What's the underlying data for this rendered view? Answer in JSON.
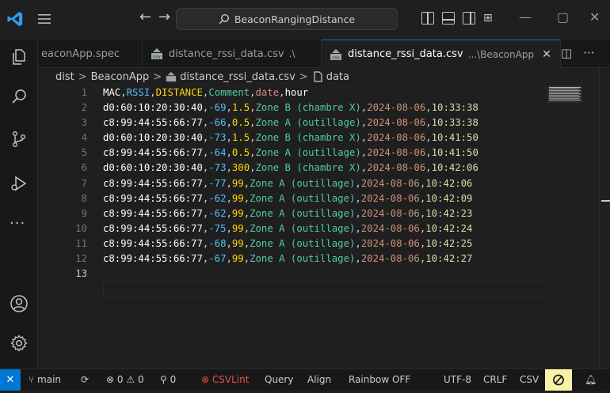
{
  "titlebar": {
    "search_text": "BeaconRangingDistance"
  },
  "tabs": [
    {
      "label": "eaconApp.spec",
      "desc": "",
      "active": false
    },
    {
      "label": "distance_rssi_data.csv",
      "desc": ".\\",
      "active": false
    },
    {
      "label": "distance_rssi_data.csv",
      "desc": "...\\BeaconApp",
      "active": true
    }
  ],
  "breadcrumb": {
    "seg1": "dist",
    "seg2": "BeaconApp",
    "seg3": "distance_rssi_data.csv",
    "seg4": "data",
    "sep": ">"
  },
  "editor": {
    "line_numbers": [
      "1",
      "2",
      "3",
      "4",
      "5",
      "6",
      "7",
      "8",
      "9",
      "10",
      "11",
      "12",
      "13"
    ],
    "header": {
      "mac": "MAC",
      "rssi": "RSSI",
      "distance": "DISTANCE",
      "comment": "Comment",
      "date": "date",
      "hour": "hour"
    },
    "rows": [
      {
        "mac": "d0:60:10:20:30:40",
        "rssi": "-69",
        "distance": "1.5",
        "comment": "Zone B (chambre X)",
        "date": "2024-08-06",
        "hour": "10:33:38"
      },
      {
        "mac": "c8:99:44:55:66:77",
        "rssi": "-66",
        "distance": "0.5",
        "comment": "Zone A (outillage)",
        "date": "2024-08-06",
        "hour": "10:33:38"
      },
      {
        "mac": "d0:60:10:20:30:40",
        "rssi": "-73",
        "distance": "1.5",
        "comment": "Zone B (chambre X)",
        "date": "2024-08-06",
        "hour": "10:41:50"
      },
      {
        "mac": "c8:99:44:55:66:77",
        "rssi": "-64",
        "distance": "0.5",
        "comment": "Zone A (outillage)",
        "date": "2024-08-06",
        "hour": "10:41:50"
      },
      {
        "mac": "d0:60:10:20:30:40",
        "rssi": "-73",
        "distance": "300",
        "comment": "Zone B (chambre X)",
        "date": "2024-08-06",
        "hour": "10:42:06"
      },
      {
        "mac": "c8:99:44:55:66:77",
        "rssi": "-77",
        "distance": "99",
        "comment": "Zone A (outillage)",
        "date": "2024-08-06",
        "hour": "10:42:06"
      },
      {
        "mac": "c8:99:44:55:66:77",
        "rssi": "-62",
        "distance": "99",
        "comment": "Zone A (outillage)",
        "date": "2024-08-06",
        "hour": "10:42:09"
      },
      {
        "mac": "c8:99:44:55:66:77",
        "rssi": "-62",
        "distance": "99",
        "comment": "Zone A (outillage)",
        "date": "2024-08-06",
        "hour": "10:42:23"
      },
      {
        "mac": "c8:99:44:55:66:77",
        "rssi": "-75",
        "distance": "99",
        "comment": "Zone A (outillage)",
        "date": "2024-08-06",
        "hour": "10:42:24"
      },
      {
        "mac": "c8:99:44:55:66:77",
        "rssi": "-68",
        "distance": "99",
        "comment": "Zone A (outillage)",
        "date": "2024-08-06",
        "hour": "10:42:25"
      },
      {
        "mac": "c8:99:44:55:66:77",
        "rssi": "-67",
        "distance": "99",
        "comment": "Zone A (outillage)",
        "date": "2024-08-06",
        "hour": "10:42:27"
      }
    ]
  },
  "statusbar": {
    "branch": "main",
    "errors": "0",
    "warnings": "0",
    "ports": "0",
    "csvlint": "CSVLint",
    "query": "Query",
    "align": "Align",
    "rainbow": "Rainbow OFF",
    "encoding": "UTF-8",
    "eol": "CRLF",
    "language": "CSV"
  },
  "colors": {
    "accent": "#0078d4",
    "rssi": "#4fc1ff",
    "distance": "#ffd700",
    "comment": "#4ec9b0",
    "date": "#ce9178",
    "hour": "#dcdcaa"
  }
}
